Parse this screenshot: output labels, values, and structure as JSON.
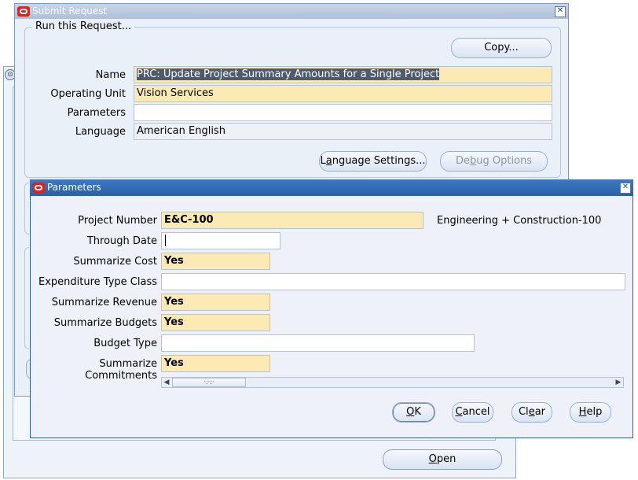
{
  "background_window": {
    "title_icon": "navigator-icon",
    "open_label": "Open"
  },
  "submit_request": {
    "title": "Submit Request",
    "group_title": "Run this Request...",
    "copy_label": "Copy...",
    "fields": {
      "name_label": "Name",
      "name_value": "PRC: Update Project Summary Amounts for a Single Project",
      "operating_unit_label": "Operating Unit",
      "operating_unit_value": "Vision Services",
      "parameters_label": "Parameters",
      "parameters_value": "",
      "language_label": "Language",
      "language_value": "American English"
    },
    "language_settings_label_pre": "L",
    "language_settings_label_u": "a",
    "language_settings_label_post": "nguage Settings...",
    "debug_options_label_pre": "De",
    "debug_options_label_u": "b",
    "debug_options_label_post": "ug Options"
  },
  "parameters": {
    "title": "Parameters",
    "rows": {
      "project_number_label": "Project Number",
      "project_number_value": "E&C-100",
      "project_number_desc": "Engineering + Construction-100",
      "through_date_label": "Through Date",
      "through_date_value": "",
      "summarize_cost_label": "Summarize Cost",
      "summarize_cost_value": "Yes",
      "expenditure_type_class_label": "Expenditure Type Class",
      "expenditure_type_class_value": "",
      "summarize_revenue_label": "Summarize Revenue",
      "summarize_revenue_value": "Yes",
      "summarize_budgets_label": "Summarize Budgets",
      "summarize_budgets_value": "Yes",
      "budget_type_label": "Budget Type",
      "budget_type_value": "",
      "summarize_commitments_label": "Summarize Commitments",
      "summarize_commitments_value": "Yes"
    },
    "buttons": {
      "ok_u": "O",
      "ok_rest": "K",
      "cancel_u": "C",
      "cancel_rest": "ancel",
      "clear_pre": "Cl",
      "clear_u": "e",
      "clear_rest": "ar",
      "help_u": "H",
      "help_rest": "elp"
    }
  },
  "colors": {
    "required_field": "#fbeab3",
    "params_titlebar": "#2a5fa8",
    "oracle_icon": "#dd2222"
  }
}
